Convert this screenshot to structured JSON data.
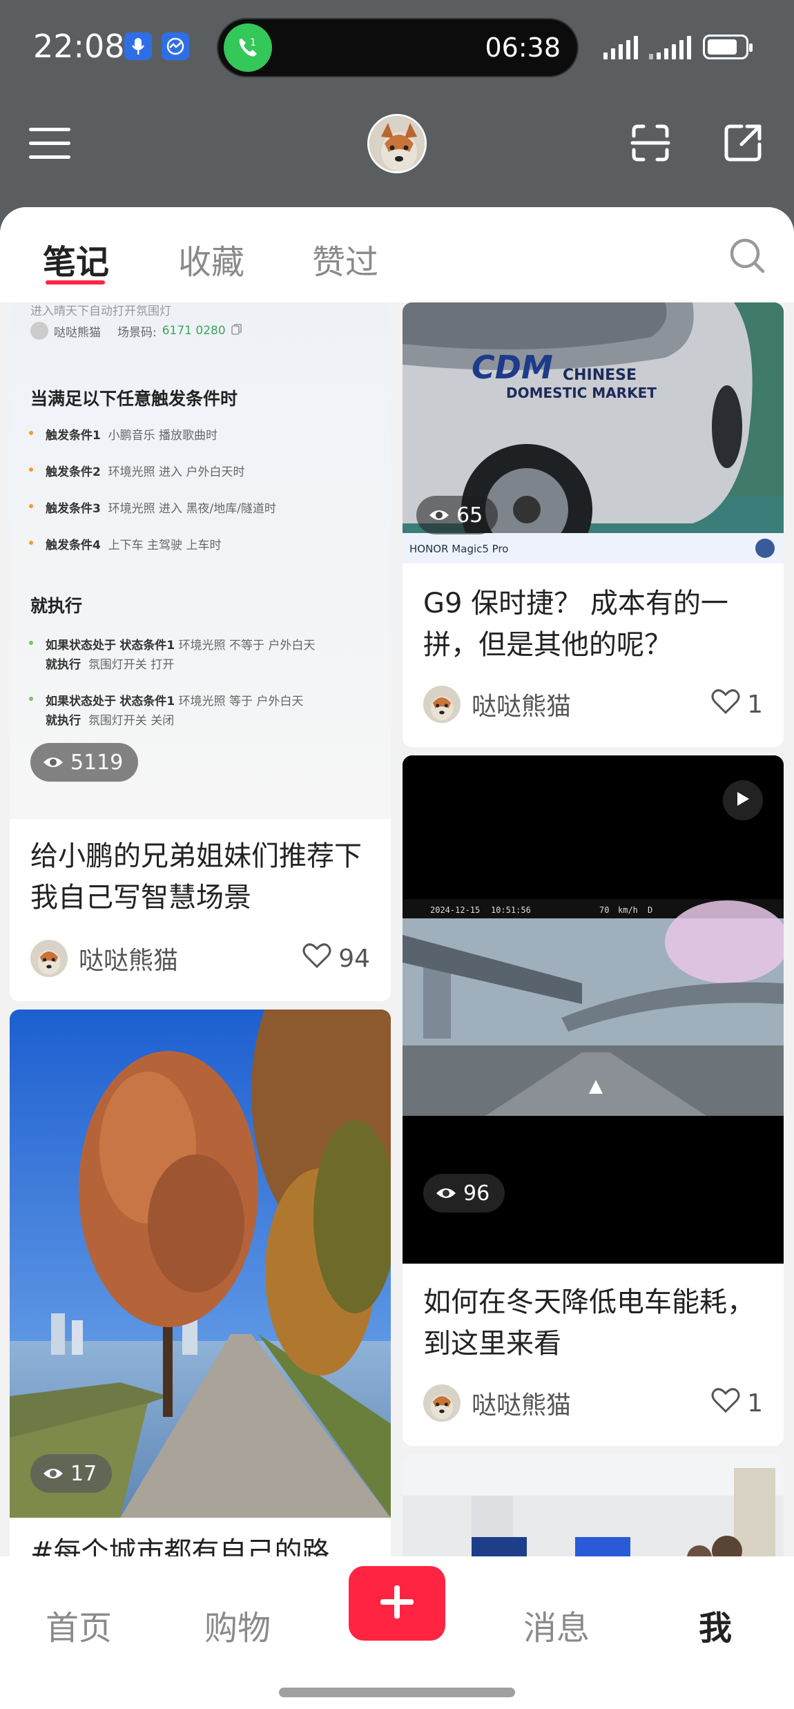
{
  "status_bar": {
    "time": "22:08",
    "call_time": "06:38"
  },
  "tabs": [
    {
      "label": "笔记"
    },
    {
      "label": "收藏"
    },
    {
      "label": "赞过"
    }
  ],
  "cards": [
    {
      "views": "5119",
      "title": "给小鹏的兄弟姐妹们推荐下我自己写智慧场景",
      "author": "哒哒熊猫",
      "likes": "94",
      "doc": {
        "top_text": "进入晴天下自动打开氛围灯",
        "author": "哒哒熊猫",
        "scene_label": "场景码:",
        "scene_code": "6171 0280",
        "trigger_heading": "当满足以下任意触发条件时",
        "triggers": [
          {
            "name": "触发条件1",
            "detail": "小鹏音乐  播放歌曲时"
          },
          {
            "name": "触发条件2",
            "detail": "环境光照  进入  户外白天时"
          },
          {
            "name": "触发条件3",
            "detail": "环境光照  进入  黑夜/地库/隧道时"
          },
          {
            "name": "触发条件4",
            "detail": "上下车  主驾驶  上车时"
          }
        ],
        "action_heading": "就执行",
        "actions": [
          {
            "line1a": "如果状态处于",
            "line1b": "状态条件1",
            "line1c": "环境光照  不等于  户外白天",
            "line2a": "就执行",
            "line2b": "氛围灯开关  打开"
          },
          {
            "line1a": "如果状态处于",
            "line1b": "状态条件1",
            "line1c": "环境光照  等于  户外白天",
            "line2a": "就执行",
            "line2b": "氛围灯开关  关闭"
          }
        ]
      }
    },
    {
      "views": "17",
      "title": "#每个城市都有自己的路"
    },
    {
      "views": "65",
      "title": "G9 保时捷？ 成本有的一拼，但是其他的呢？",
      "author": "哒哒熊猫",
      "likes": "1",
      "car_text_1": "CHINESE",
      "car_text_2": "DOMESTIC MARKET",
      "photo_watermark": "HONOR Magic5 Pro"
    },
    {
      "views": "96",
      "title": "如何在冬天降低电车能耗，到这里来看",
      "author": "哒哒熊猫",
      "likes": "1",
      "dashcam_date": "2024-12-15",
      "dashcam_time": "10:51:56",
      "dashcam_speed": "70",
      "dashcam_unit": "km/h",
      "dashcam_gear": "D"
    }
  ],
  "bottom_nav": {
    "home": "首页",
    "shop": "购物",
    "messages": "消息",
    "me": "我"
  },
  "colors": {
    "accent": "#ff2442",
    "header_bg": "#5b5e61"
  }
}
